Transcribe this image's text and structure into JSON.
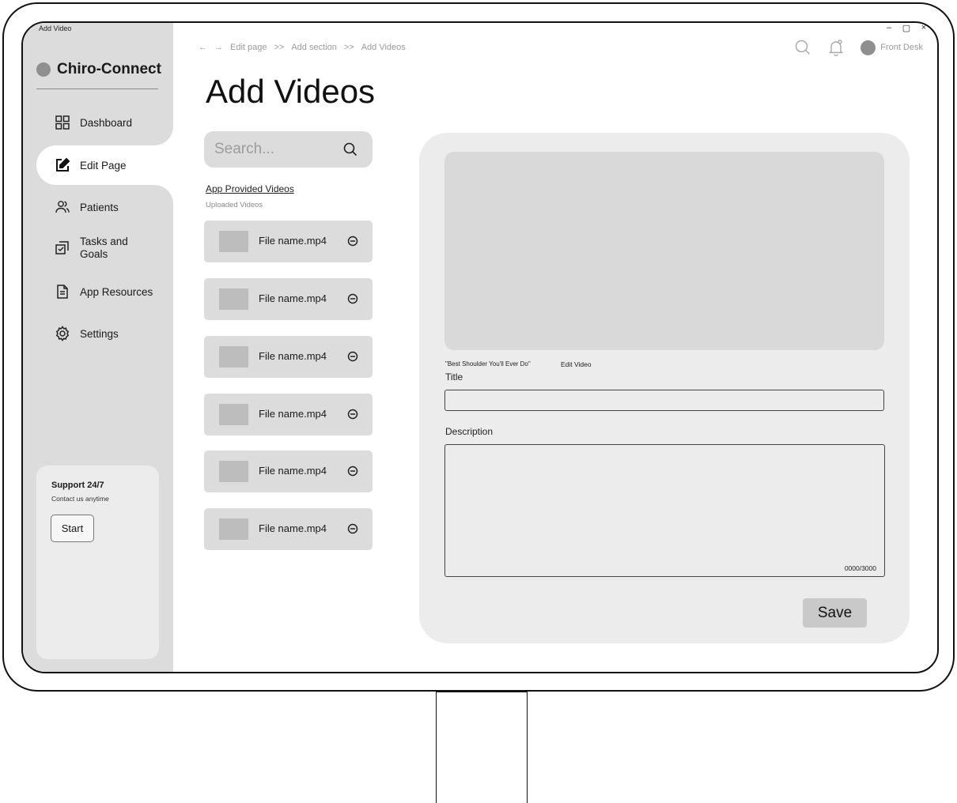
{
  "window": {
    "title": "Add Video",
    "minimize": "–",
    "restore": "▢",
    "close": "×"
  },
  "brand": {
    "name": "Chiro-Connect"
  },
  "sidebar": {
    "items": [
      {
        "label": "Dashboard",
        "icon": "grid-icon"
      },
      {
        "label": "Edit Page",
        "icon": "edit-icon",
        "active": true
      },
      {
        "label": "Patients",
        "icon": "users-icon"
      },
      {
        "label": "Tasks and Goals",
        "icon": "tasks-icon"
      },
      {
        "label": "App Resources",
        "icon": "document-icon"
      },
      {
        "label": "Settings",
        "icon": "gear-icon"
      }
    ],
    "support": {
      "title": "Support 24/7",
      "subtitle": "Contact us anytime",
      "button": "Start"
    }
  },
  "header": {
    "breadcrumb": [
      "Edit page",
      "Add section",
      "Add Videos"
    ],
    "user": "Front Desk"
  },
  "page": {
    "title": "Add Videos"
  },
  "library": {
    "search_placeholder": "Search...",
    "tab_app": "App Provided Videos",
    "tab_uploaded": "Uploaded Videos",
    "files": [
      {
        "name": "File name.mp4"
      },
      {
        "name": "File name.mp4"
      },
      {
        "name": "File name.mp4"
      },
      {
        "name": "File name.mp4"
      },
      {
        "name": "File name.mp4"
      },
      {
        "name": "File name.mp4"
      }
    ]
  },
  "editor": {
    "caption": "\"Best Shoulder You'll Ever Do\"",
    "edit_video": "Edit Video",
    "title_label": "Title",
    "title_value": "",
    "description_label": "Description",
    "char_count": "0000/3000",
    "save": "Save"
  },
  "colors": {
    "sidebar": "#dcdcdc",
    "panel": "#ececec",
    "accent_gray": "#8f8f8f"
  }
}
